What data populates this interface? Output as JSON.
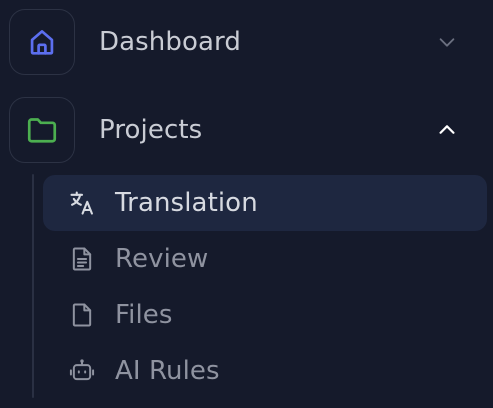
{
  "sidebar": {
    "sections": [
      {
        "label": "Dashboard",
        "icon": "home-icon",
        "icon_color": "#5c6ff0",
        "expanded": false,
        "chevron": "chevron-down-icon"
      },
      {
        "label": "Projects",
        "icon": "folder-icon",
        "icon_color": "#4caf50",
        "expanded": true,
        "chevron": "chevron-up-icon"
      }
    ],
    "subitems": [
      {
        "label": "Translation",
        "icon": "translate-icon",
        "active": true
      },
      {
        "label": "Review",
        "icon": "document-text-icon",
        "active": false
      },
      {
        "label": "Files",
        "icon": "file-icon",
        "active": false
      },
      {
        "label": "AI Rules",
        "icon": "robot-icon",
        "active": false
      }
    ]
  },
  "colors": {
    "background": "#151a2b",
    "active_background": "#1e2740",
    "text_primary": "#c9ccd4",
    "text_secondary": "#8f93a0",
    "text_active": "#d7dae1",
    "border": "#2c3244"
  }
}
